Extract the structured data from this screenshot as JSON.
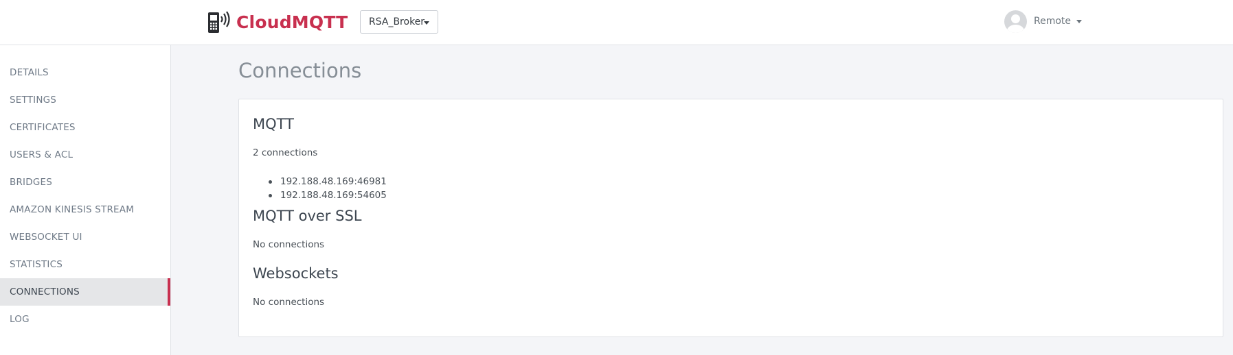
{
  "header": {
    "brand": "CloudMQTT",
    "instance_select": "RSA_Broker",
    "user_name": "Remote"
  },
  "sidebar": {
    "items": [
      {
        "label": "DETAILS"
      },
      {
        "label": "SETTINGS"
      },
      {
        "label": "CERTIFICATES"
      },
      {
        "label": "USERS & ACL"
      },
      {
        "label": "BRIDGES"
      },
      {
        "label": "AMAZON KINESIS STREAM"
      },
      {
        "label": "WEBSOCKET UI"
      },
      {
        "label": "STATISTICS"
      },
      {
        "label": "CONNECTIONS",
        "active": true
      },
      {
        "label": "LOG"
      }
    ]
  },
  "main": {
    "title": "Connections",
    "sections": {
      "mqtt": {
        "title": "MQTT",
        "count_text": "2 connections",
        "connections": [
          "192.188.48.169:46981",
          "192.188.48.169:54605"
        ]
      },
      "mqtt_ssl": {
        "title": "MQTT over SSL",
        "status_text": "No connections"
      },
      "websockets": {
        "title": "Websockets",
        "status_text": "No connections"
      }
    }
  },
  "colors": {
    "brand": "#c8304f",
    "active_indicator": "#c8304f",
    "page_background": "#f4f5f8"
  },
  "icons": {
    "brand": "mobile-signal-icon",
    "avatar": "user-avatar-icon",
    "dropdown": "caret-down-icon"
  }
}
